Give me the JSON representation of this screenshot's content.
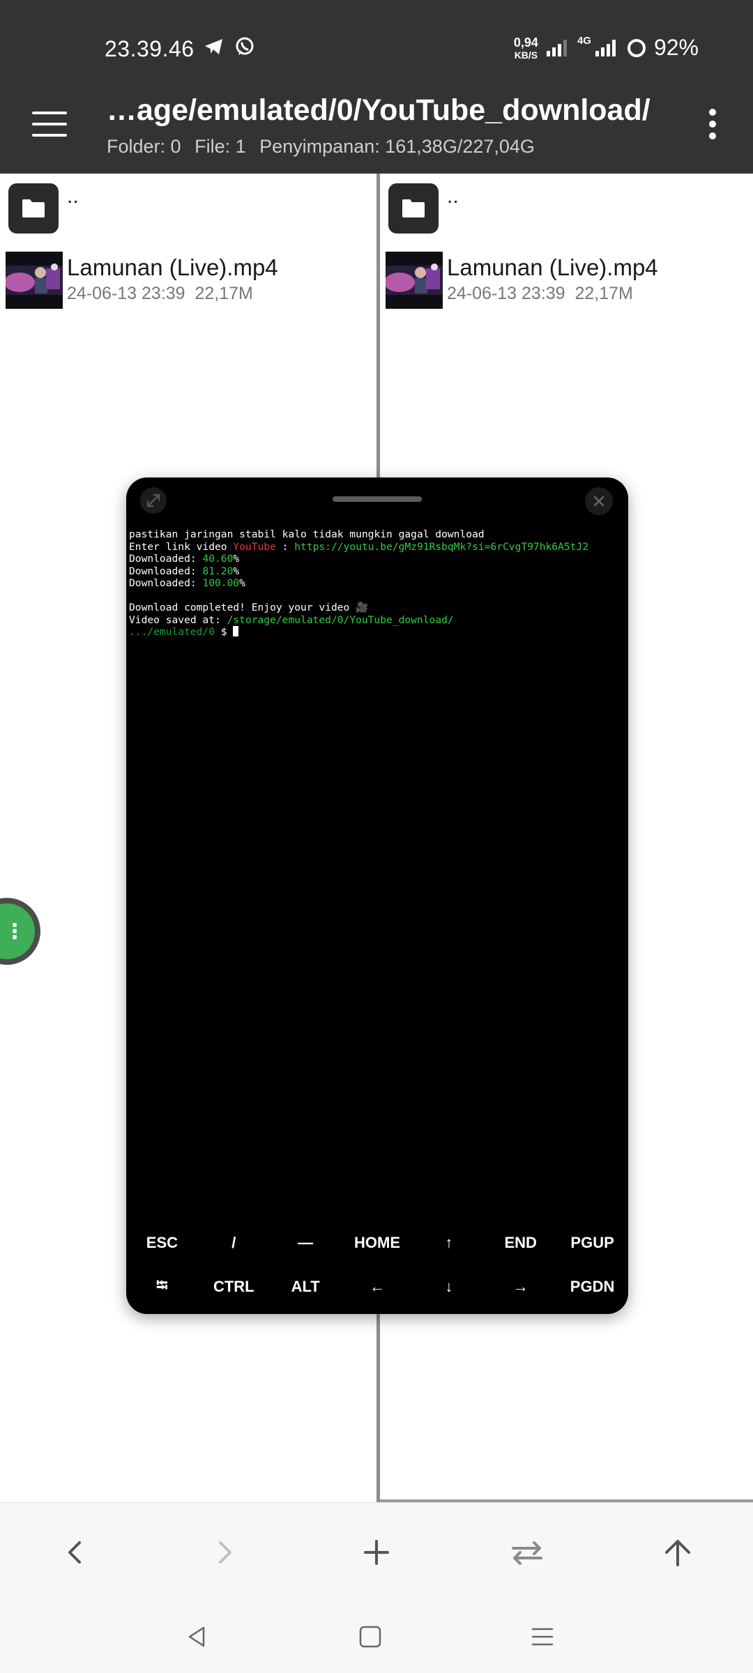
{
  "status_bar": {
    "time": "23.39.46",
    "netspeed_value": "0,94",
    "netspeed_unit": "KB/S",
    "network_type": "4G",
    "battery": "92%"
  },
  "app_bar": {
    "path": "…age/emulated/0/YouTube_download/",
    "folder_count": "Folder: 0",
    "file_count": "File: 1",
    "storage": "Penyimpanan: 161,38G/227,04G"
  },
  "panes": [
    {
      "parent_label": "..",
      "files": [
        {
          "name": "Lamunan (Live).mp4",
          "date": "24-06-13 23:39",
          "size": "22,17M"
        }
      ]
    },
    {
      "parent_label": "..",
      "files": [
        {
          "name": "Lamunan (Live).mp4",
          "date": "24-06-13 23:39",
          "size": "22,17M"
        }
      ]
    }
  ],
  "terminal": {
    "line1": "pastikan jaringan stabil kalo tidak mungkin gagal download",
    "line2_prefix": "Enter link video ",
    "line2_service": "YouTube",
    "line2_sep": " : ",
    "line2_url": "https://youtu.be/gMz91RsbqMk?si=6rCvgT97hk6A5tJ2",
    "downloaded_label": "Downloaded: ",
    "progress": [
      "40.60",
      "81.20",
      "100.00"
    ],
    "percent_sign": "%",
    "completed": "Download completed! Enjoy your video 🎥",
    "saved_label": "Video saved at: ",
    "saved_path": "/storage/emulated/0/YouTube_download/",
    "prompt_dir": ".../emulated/0",
    "prompt_symbol": " $ ",
    "keys_row1": [
      "ESC",
      "/",
      "—",
      "HOME",
      "↑",
      "END",
      "PGUP"
    ],
    "keys_row2": [
      "⭾",
      "CTRL",
      "ALT",
      "←",
      "↓",
      "→",
      "PGDN"
    ]
  },
  "colors": {
    "topbar": "#333333",
    "terminal_bg": "#000000",
    "accent_green": "#3fae57",
    "youtube_red": "#e53935",
    "term_green": "#2ecc40"
  },
  "icons": {
    "toolbar": [
      "chevron-left-icon",
      "chevron-right-icon",
      "plus-icon",
      "swap-icon",
      "arrow-up-icon"
    ],
    "navbar": [
      "nav-back-icon",
      "nav-home-icon",
      "nav-recents-icon"
    ]
  }
}
